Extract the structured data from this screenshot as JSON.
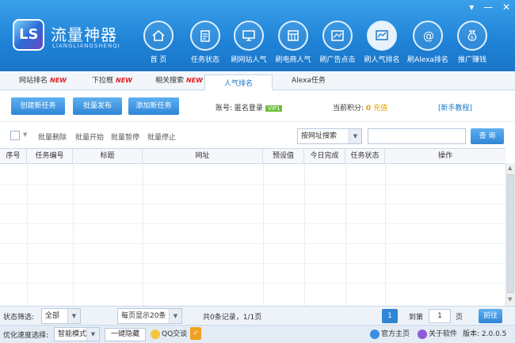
{
  "app": {
    "name": "流量神器",
    "sub": "LIANGLIANGSHENQI",
    "logo_text": "LS"
  },
  "nav": [
    {
      "label": "首 页",
      "icon": "home-icon"
    },
    {
      "label": "任务状态",
      "icon": "tasks-icon"
    },
    {
      "label": "刷网站人气",
      "icon": "monitor-icon"
    },
    {
      "label": "刷电商人气",
      "icon": "shop-icon"
    },
    {
      "label": "刷广告点击",
      "icon": "ad-icon"
    },
    {
      "label": "刷人气排名",
      "icon": "chart-icon"
    },
    {
      "label": "刷Alexa排名",
      "icon": "at-icon"
    },
    {
      "label": "推广赚钱",
      "icon": "money-icon"
    }
  ],
  "tabs": [
    {
      "label": "网站排名",
      "new": "NEW"
    },
    {
      "label": "下拉框",
      "new": "NEW"
    },
    {
      "label": "相关搜索",
      "new": "NEW"
    },
    {
      "label": "人气排名",
      "new": ""
    },
    {
      "label": "Alexa任务",
      "new": ""
    }
  ],
  "toolbar": {
    "create": "创建新任务",
    "batch_publish": "批量发布",
    "add_new_task": "添加新任务",
    "account_label": "账号:",
    "account_value": "匿名登录",
    "vip": "VIP1",
    "points_label": "当前积分:",
    "points_value": "0",
    "recharge": "充值",
    "tutorial": "[新手教程]"
  },
  "actions": {
    "batch_delete": "批量删除",
    "batch_start": "批量开始",
    "batch_pause": "批量暂停",
    "batch_stop": "批量停止",
    "search_mode": "按网址搜索",
    "search_btn": "查 询"
  },
  "table": {
    "columns": [
      "序号",
      "任务编号",
      "标题",
      "网址",
      "预设值",
      "今日完成",
      "任务状态",
      "操作"
    ]
  },
  "footer": {
    "status_label": "状态筛选:",
    "status_value": "全部",
    "per_page": "每页显示20条",
    "records": "共0条记录，1/1页",
    "current_page": "1",
    "goto_label": "到第",
    "goto_value": "1",
    "page_suffix": "页",
    "go": "前往",
    "speed_label": "优化速度选择:",
    "speed_value": "智能模式",
    "hide_btn": "一键隐藏",
    "qq": "QQ交谈",
    "official_site": "官方主页",
    "about": "关于软件",
    "version": "版本: 2.0.0.5"
  },
  "colors": {
    "header": "#1f82d6",
    "button": "#2f86d6",
    "accent_new": "#e02020",
    "points": "#e9a100"
  }
}
